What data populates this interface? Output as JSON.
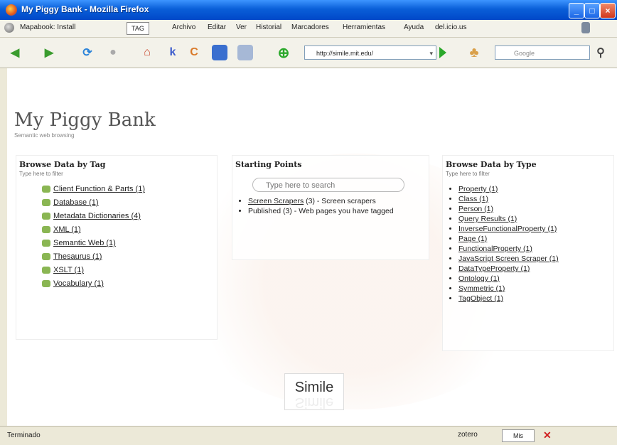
{
  "window": {
    "title": "My Piggy Bank - Mozilla Firefox"
  },
  "menubar": {
    "items": [
      "Mapabook: Install",
      "Archivo",
      "Editar",
      "Ver",
      "Historial",
      "Marcadores",
      "Herramientas",
      "Ayuda",
      "del.icio.us"
    ],
    "tag_label": "TAG"
  },
  "toolbar": {
    "url": "http://simile.mit.edu/",
    "search_placeholder": "Google"
  },
  "page": {
    "title": "My Piggy Bank",
    "subtitle": "Semantic web browsing"
  },
  "tags_panel": {
    "title": "Browse Data by Tag",
    "subtitle": "Type here to filter",
    "items": [
      "Client Function & Parts (1)",
      "Database (1)",
      "Metadata Dictionaries (4)",
      "XML (1)",
      "Semantic Web (1)",
      "Thesaurus (1)",
      "XSLT (1)",
      "Vocabulary (1)"
    ]
  },
  "starting_points": {
    "title": "Starting Points",
    "search_placeholder": "Type here to search",
    "items": [
      {
        "link": "Screen Scrapers",
        "text": " (3) - Screen scrapers"
      },
      {
        "link": "",
        "text": "Published (3) - Web pages you have tagged"
      }
    ]
  },
  "types_panel": {
    "title": "Browse Data by Type",
    "subtitle": "Type here to filter",
    "items": [
      "Property (1)",
      "Class (1)",
      "Person (1)",
      "Query Results (1)",
      "InverseFunctionalProperty (1)",
      "Page (1)",
      "FunctionalProperty (1)",
      "JavaScript Screen Scraper (1)",
      "DataTypeProperty (1)",
      "Ontology (1)",
      "Symmetric (1)",
      "TagObject (1)"
    ]
  },
  "logo": {
    "text": "Simile"
  },
  "statusbar": {
    "status": "Terminado",
    "zotero": "zotero",
    "button": "Mis"
  },
  "colors": {
    "titlebar": "#0a5fd8",
    "tag_icon": "#8ab653"
  }
}
